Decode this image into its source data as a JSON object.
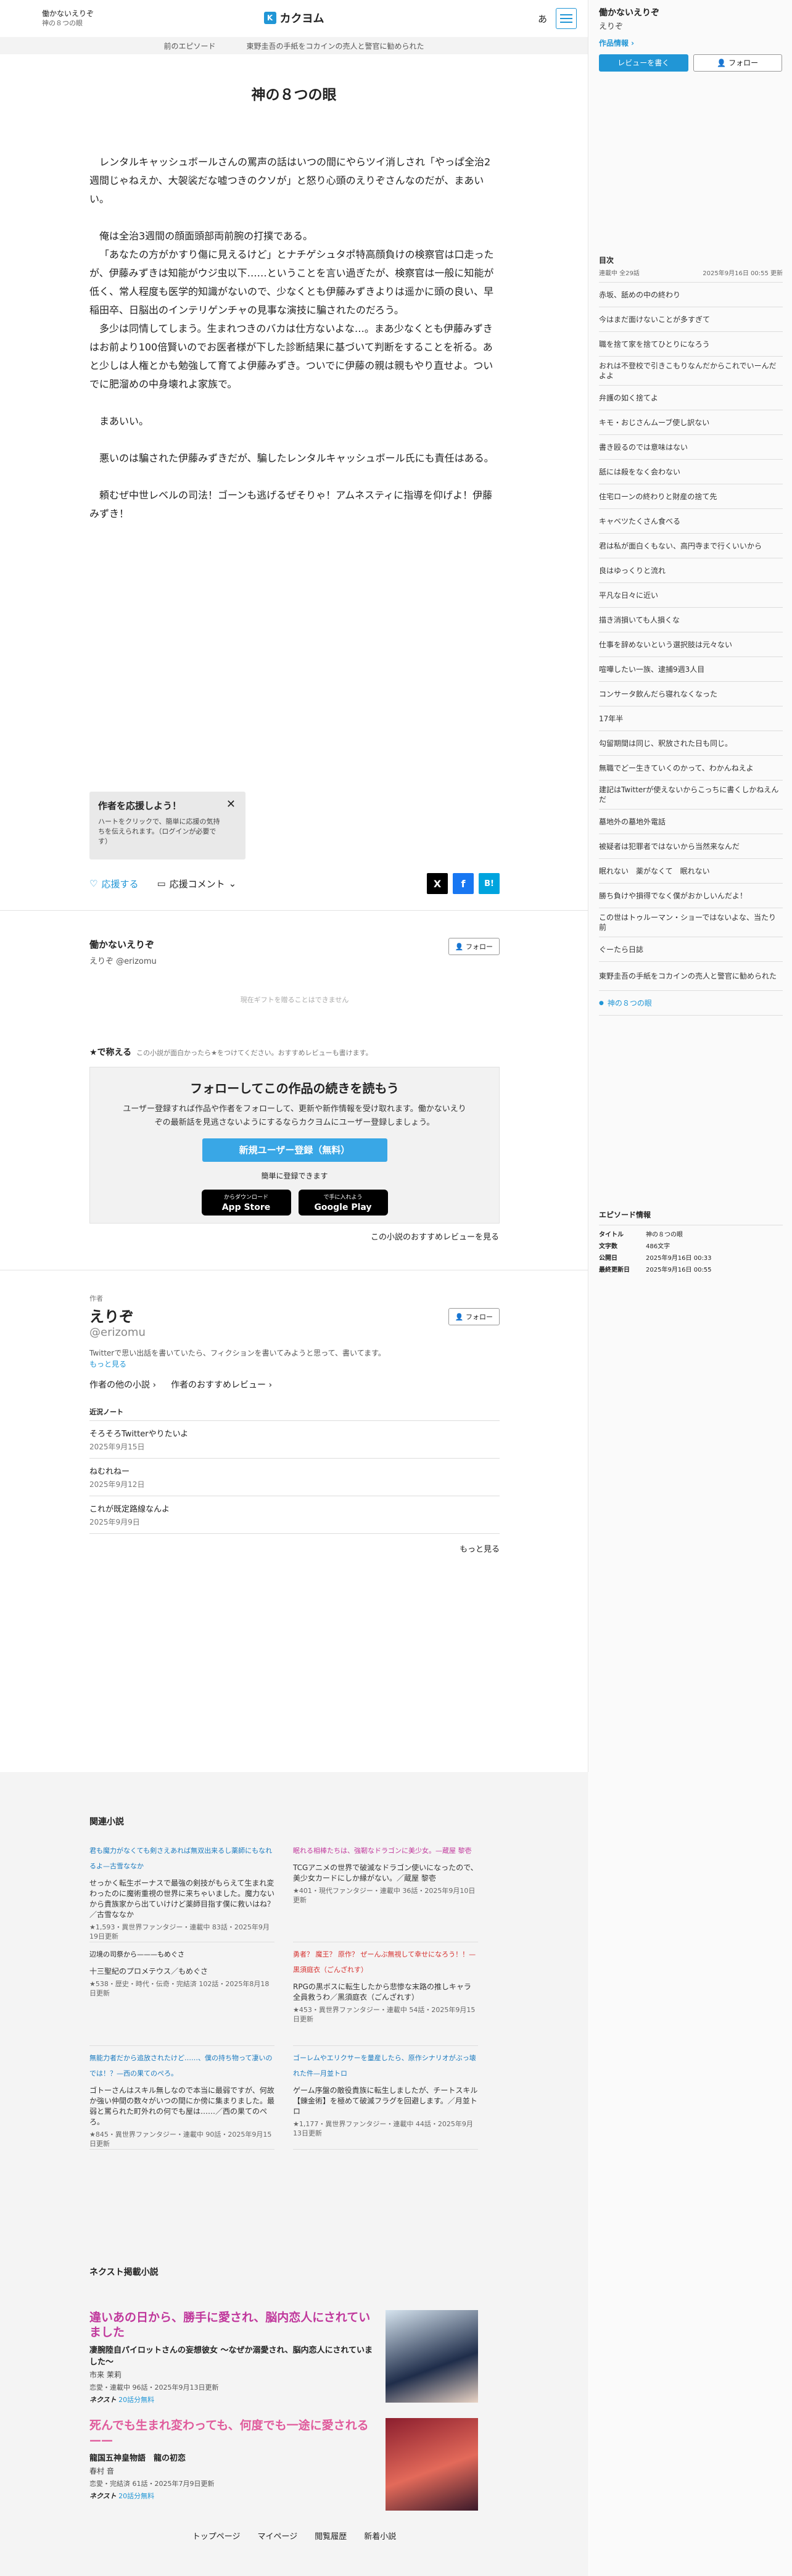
{
  "header": {
    "work_title": "働かないえりぞ",
    "episode_num": "神の８つの眼",
    "logo": "カクヨム",
    "font_btn": "あ"
  },
  "crumb": {
    "prev": "前のエピソード",
    "prev_title": "東野圭吾の手紙をコカインの売人と警官に勧められた"
  },
  "episode": {
    "title": "神の８つの眼",
    "paragraphs": [
      "",
      "レンタルキャッシュボールさんの罵声の話はいつの間にやらツイ消しされ「やっぱ全治2週間じゃねえか、大袈裟だな嘘つきのクソが」と怒り心頭のえりぞさんなのだが、まあいい。",
      "",
      "俺は全治3週間の顔面頭部両前腕の打撲である。",
      "「あなたの方がかすり傷に見えるけど」とナチゲシュタポ特高顔負けの検察官は口走ったが、伊藤みずきは知能がウジ虫以下……ということを言い過ぎたが、検察官は一般に知能が低く、常人程度も医学的知識がないので、少なくとも伊藤みずきよりは遥かに頭の良い、早稲田卒、日脳出のインテリゲンチャの見事な演技に騙されたのだろう。",
      "多少は同情してしまう。生まれつきのバカは仕方ないよな…。まあ少なくとも伊藤みずきはお前より100倍賢いのでお医者様が下した診断結果に基づいて判断をすることを祈る。あと少しは人権とかも勉強して育てよ伊藤みずき。ついでに伊藤の親は親もやり直せよ。ついでに肥溜めの中身壊れよ家族で。",
      "",
      "まあいい。",
      "",
      "悪いのは騙された伊藤みずきだが、騙したレンタルキャッシュボール氏にも責任はある。",
      "",
      "頼むぜ中世レベルの司法！ゴーンも逃げるぜそりゃ！アムネスティに指導を仰げよ！伊藤みずき！"
    ]
  },
  "support": {
    "title": "作者を応援しよう！",
    "desc": "ハートをクリックで、簡単に応援の気持ちを伝えられます。（ログインが必要です）"
  },
  "actions": {
    "heart": "応援する",
    "comment": "応援コメント",
    "share": [
      "X",
      "f",
      "B!"
    ]
  },
  "author_card": {
    "name": "働かないえりぞ",
    "handle": "えりぞ @erizomu",
    "follow": "フォロー"
  },
  "gift": "現在ギフトを贈ることはできません",
  "review": {
    "label": "★で称える",
    "hint": "この小説が面白かったら★をつけてください。おすすめレビューも書けます。"
  },
  "cta": {
    "title": "フォローしてこの作品の続きを読もう",
    "desc": "ユーザー登録すれば作品や作者をフォローして、更新や新作情報を受け取れます。働かないえりぞの最新話を見逃さないようにするならカクヨムにユーザー登録しましょう。",
    "register": "新規ユーザー登録（無料）",
    "note": "簡単に登録できます",
    "appstore": "App Store",
    "appstore_sub": "からダウンロード",
    "gplay": "Google Play",
    "gplay_sub": "で手に入れよう"
  },
  "more_reviews": "この小説のおすすめレビューを見る",
  "author": {
    "label": "作者",
    "name": "えりぞ",
    "handle": "@erizomu",
    "desc": "Twitterで思い出話を書いていたら、フィクションを書いてみようと思って、書いてます。",
    "more": "もっと見る",
    "link1": "作者の他の小説 ›",
    "link2": "作者のおすすめレビュー ›",
    "news_head": "近況ノート",
    "news": [
      {
        "title": "そろそろTwitterやりたいよ",
        "date": "2025年9月15日"
      },
      {
        "title": "ねむれねー",
        "date": "2025年9月12日"
      },
      {
        "title": "これが既定路線なんよ",
        "date": "2025年9月9日"
      }
    ],
    "news_more": "もっと見る"
  },
  "related": {
    "head": "関連小説",
    "items": [
      {
        "title": "君も魔力がなくても剣さえあれば無双出来るし薬師にもなれるよ",
        "by": "—古雪ななか",
        "color": "#1a7abf",
        "desc": "せっかく転生ボーナスで最強の剣技がもらえて生まれ変わったのに魔術重視の世界に来ちゃいました。魔力ないから貴族家から出ていけけど薬師目指す僕に救いはね？／古雪ななか",
        "meta": "★1,593・異世界ファンタジー・連載中 83話・2025年9月19日更新"
      },
      {
        "title": "眠れる相棒たちは、強靭なドラゴンに美少女。",
        "by": "—蔵屋 黎壱",
        "color": "#c0389c",
        "desc": "TCGアニメの世界で破滅なドラゴン使いになったので、美少女カードにしか縁がない。／蔵屋 黎壱",
        "meta": "★401・現代ファンタジー・連載中 36話・2025年9月10日更新"
      },
      {
        "title": "辺境の司祭から——",
        "by": "—もめぐさ",
        "color": "#222",
        "desc": "十三聖紀のプロメテウス／もめぐさ",
        "meta": "★538・歴史・時代・伝奇・完結済 102話・2025年8月18日更新"
      },
      {
        "title": "勇者？ 魔王？ 原作？ ぜーんぶ無視して幸せになろう！！",
        "by": "—黒須庭衣（ごんざれす）",
        "color": "#d6302e",
        "desc": "RPGの黒ボスに転生したから悲惨な末路の推しキャラ全員救うわ／黒須庭衣（ごんざれす）",
        "meta": "★453・異世界ファンタジー・連載中 54話・2025年9月15日更新"
      },
      {
        "title": "無能力者だから追放されたけど……、僕の持ち物って凄いのでは！？",
        "by": "—西の果てのぺろ。",
        "color": "#1a7abf",
        "desc": "ゴトーさんはスキル無しなので本当に最弱ですが、何故か強い仲間の数々がいつの間にか傍に集まりました。最弱と罵られた町外れの何でも屋は……／西の果てのぺろ。",
        "meta": "★845・異世界ファンタジー・連載中 90話・2025年9月15日更新"
      },
      {
        "title": "ゴーレムやエリクサーを量産したら、原作シナリオがぶっ壊れた件",
        "by": "—月並トロ",
        "color": "#1a7abf",
        "desc": "ゲーム序盤の敵役貴族に転生しましたが、チートスキル【錬金術】を極めて破滅フラグを回避します。／月並トロ",
        "meta": "★1,177・異世界ファンタジー・連載中 44話・2025年9月13日更新"
      }
    ]
  },
  "next": {
    "head": "ネクスト掲載小説",
    "items": [
      {
        "title": "違いあの日から、勝手に愛され、脳内恋人にされていました",
        "sub": "凄腕陸自パイロットさんの妄想彼女 〜なぜか溺愛され、脳内恋人にされていました〜",
        "author": "市来 茉莉",
        "meta": "恋愛・連載中 96話・2025年9月13日更新",
        "brand": "ネクスト",
        "free": "20話分無料"
      },
      {
        "title": "死んでも生まれ変わっても、何度でも一途に愛される——",
        "sub": "龍国五神皇物語　龍の初恋",
        "author": "春村 音",
        "meta": "恋愛・完結済 61話・2025年7月9日更新",
        "brand": "ネクスト",
        "free": "20話分無料"
      }
    ]
  },
  "footer": [
    "トップページ",
    "マイページ",
    "閲覧履歴",
    "新着小説"
  ],
  "side": {
    "title": "働かないえりぞ",
    "author": "えりぞ",
    "work_info": "作品情報 ›",
    "read": "レビューを書く",
    "follow": "フォロー"
  },
  "toc": {
    "head": "目次",
    "status": "連載中 全29話",
    "updated": "2025年9月16日 00:55 更新",
    "episodes": [
      "赤坂、舐めの中の終わり",
      "今はまだ面けないことが多すぎて",
      "職を捨て家を捨てひとりになろう",
      "おれは不登校で引きこもりなんだからこれでいーんだよよ",
      "弁護の如く捨てよ",
      "キモ・おじさんムーブ使し訳ない",
      "書き殴るのでは意味はない",
      "舐には殺をなく会わない",
      "住宅ローンの終わりと財産の捨て先",
      "キャベツたくさん食べる",
      "君は私が面白くもない、高円寺まで行くいいから",
      "良はゆっくりと流れ",
      "平凡な日々に近い",
      "描き消損いても人損くな",
      "仕事を辞めないという選択肢は元々ない",
      "喧嘩したい一族、逮捕9週3人目",
      "コンサータ飲んだら寝れなくなった",
      "17年半",
      "勾留期間は同じ、釈放された日も同じ。",
      "無職でどー生きていくのかって、わかんねえよ",
      "建記はTwitterが使えないからこっちに書くしかねえんだ",
      "墓地外の墓地外電話",
      "被疑者は犯罪者ではないから当然来なんだ",
      "眠れない　薬がなくて　眠れない",
      "勝ち負けや損得でなく僕がおかしいんだよ！",
      "この世はトゥルーマン・ショーではないよな、当たり前",
      "ぐーたら日誌",
      "東野圭吾の手紙をコカインの売人と警官に勧められた",
      "神の８つの眼"
    ],
    "current": 28
  },
  "ep_info": {
    "head": "エピソード情報",
    "rows": [
      [
        "タイトル",
        "神の８つの眼"
      ],
      [
        "文字数",
        "486文字"
      ],
      [
        "公開日",
        "2025年9月16日 00:33"
      ],
      [
        "最終更新日",
        "2025年9月16日 00:55"
      ]
    ]
  },
  "colors": {
    "accent": "#2196d6",
    "pink": "#c0389c",
    "red": "#d6302e"
  }
}
